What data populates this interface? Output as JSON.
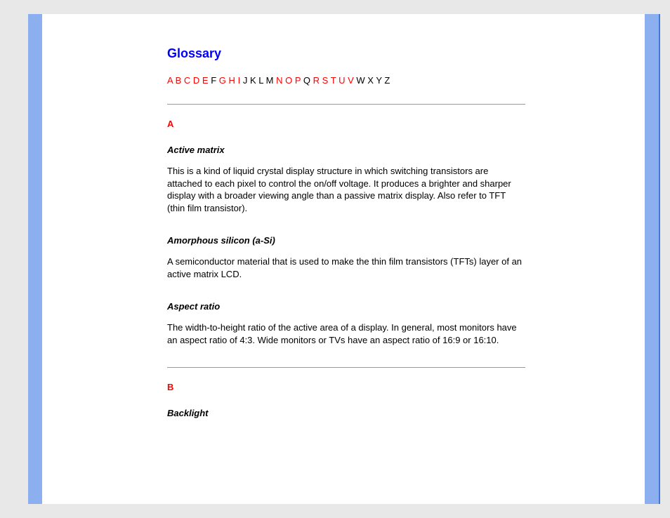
{
  "title": "Glossary",
  "alpha": {
    "letters": [
      "A",
      "B",
      "C",
      "D",
      "E",
      "F",
      "G",
      "H",
      "I",
      "J",
      "K",
      "L",
      "M",
      "N",
      "O",
      "P",
      "Q",
      "R",
      "S",
      "T",
      "U",
      "V",
      "W",
      "X",
      "Y",
      "Z"
    ],
    "linked": [
      "A",
      "B",
      "C",
      "D",
      "E",
      "G",
      "H",
      "I",
      "N",
      "O",
      "P",
      "R",
      "S",
      "T",
      "U",
      "V"
    ]
  },
  "sections": [
    {
      "letter": "A",
      "entries": [
        {
          "term": "Active matrix",
          "description": "This is a kind of liquid crystal display structure in which switching transistors are attached to each pixel to control the on/off voltage. It produces a brighter and sharper display with a broader viewing angle than a passive matrix display. Also refer to TFT (thin film transistor)."
        },
        {
          "term": "Amorphous silicon (a-Si)",
          "description": "A semiconductor material that is used to make the thin film transistors (TFTs) layer of an active matrix LCD."
        },
        {
          "term": "Aspect ratio",
          "description": "The width-to-height ratio of the active area of a display. In general, most monitors have an aspect ratio of 4:3. Wide monitors or TVs have an aspect ratio of 16:9 or 16:10."
        }
      ],
      "hr_after": true
    },
    {
      "letter": "B",
      "entries": [
        {
          "term": "Backlight",
          "description": ""
        }
      ],
      "hr_after": false
    }
  ]
}
